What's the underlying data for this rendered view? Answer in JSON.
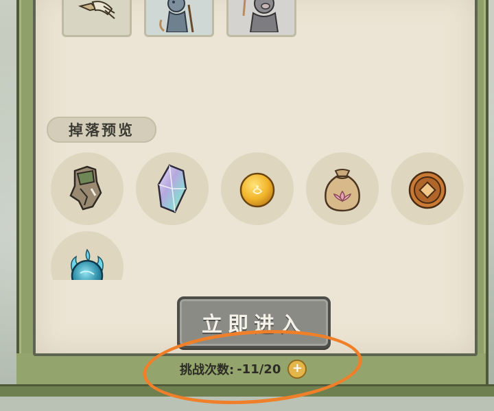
{
  "drop_section": {
    "title": "掉落预览",
    "items": [
      {
        "icon": "rock-shard-icon"
      },
      {
        "icon": "crystal-icon"
      },
      {
        "icon": "gold-orb-icon"
      },
      {
        "icon": "lotus-pouch-icon"
      },
      {
        "icon": "copper-coin-icon"
      },
      {
        "icon": "spirit-orb-icon"
      }
    ]
  },
  "enemies": [
    {
      "icon": "bird-monster-icon"
    },
    {
      "icon": "boar-archer-icon"
    },
    {
      "icon": "boar-warrior-icon"
    }
  ],
  "enter_button": {
    "label": "立即进入"
  },
  "challenge": {
    "label": "挑战次数:",
    "value": "-11/20",
    "add_icon": "plus-icon"
  },
  "colors": {
    "frame_green": "#8fa06a",
    "parchment": "#ece4d4",
    "button_gray": "#8b8b86",
    "annotation_orange": "#f07f2a"
  }
}
